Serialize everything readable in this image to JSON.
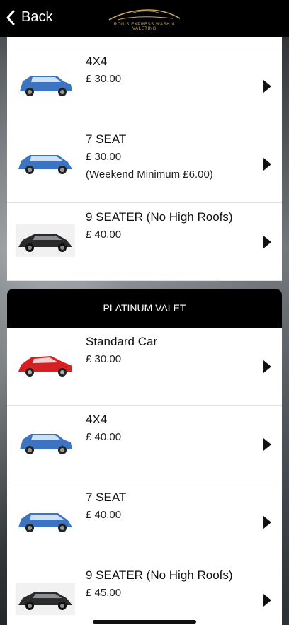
{
  "header": {
    "back_label": "Back",
    "logo_text": "RONIS EXPRESS WASH & VALETING"
  },
  "section1": {
    "items": [
      {
        "name": "4X4",
        "price": "£ 30.00",
        "note": "",
        "car_color": "#3d74c2"
      },
      {
        "name": "7 SEAT",
        "price": "£ 30.00",
        "note": "(Weekend Minimum £6.00)",
        "car_color": "#3d74c2"
      },
      {
        "name": "9 SEATER (No High Roofs)",
        "price": "£ 40.00",
        "note": "",
        "car_color": "#2b2b2b"
      }
    ]
  },
  "section2": {
    "title": "PLATINUM VALET",
    "items": [
      {
        "name": "Standard Car",
        "price": "£ 30.00",
        "note": "",
        "car_color": "#d62024"
      },
      {
        "name": "4X4",
        "price": "£ 40.00",
        "note": "",
        "car_color": "#3d74c2"
      },
      {
        "name": "7 SEAT",
        "price": "£ 40.00",
        "note": "",
        "car_color": "#3d74c2"
      },
      {
        "name": "9 SEATER (No High Roofs)",
        "price": "£ 45.00",
        "note": "",
        "car_color": "#2b2b2b"
      }
    ]
  },
  "icons": {
    "back": "chevron-left-icon",
    "row_arrow": "play-triangle-icon"
  }
}
